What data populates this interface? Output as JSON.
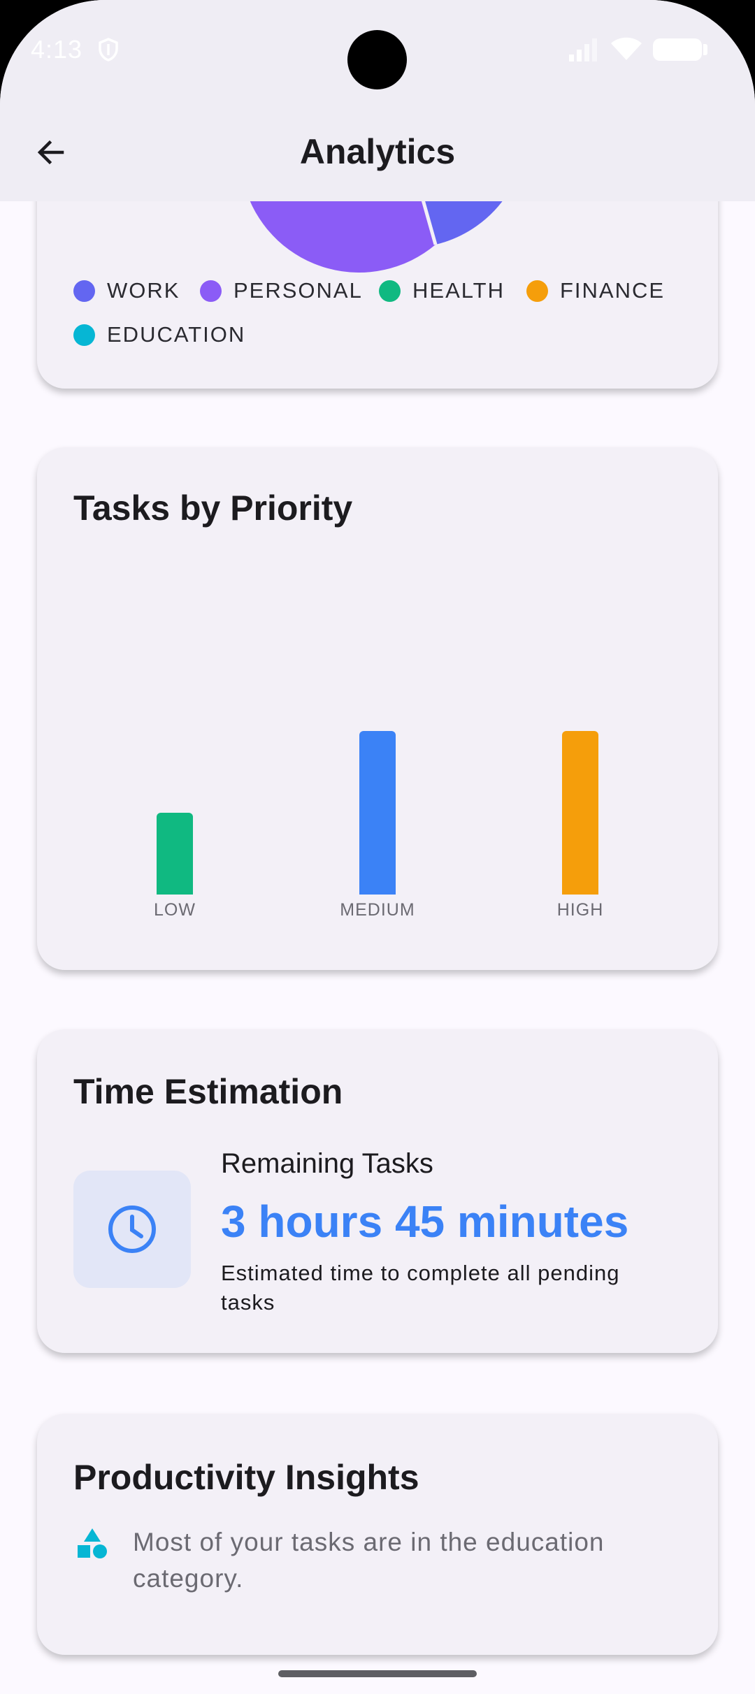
{
  "status_bar": {
    "time": "4:13"
  },
  "app_bar": {
    "title": "Analytics"
  },
  "category_card": {
    "legend": [
      {
        "label": "WORK",
        "color": "#6366f1"
      },
      {
        "label": "PERSONAL",
        "color": "#8b5cf6"
      },
      {
        "label": "HEALTH",
        "color": "#10b981"
      },
      {
        "label": "FINANCE",
        "color": "#f59e0b"
      },
      {
        "label": "EDUCATION",
        "color": "#06b6d4"
      }
    ]
  },
  "priority_card": {
    "title": "Tasks by Priority"
  },
  "chart_data": {
    "type": "bar",
    "title": "Tasks by Priority",
    "categories": [
      "LOW",
      "MEDIUM",
      "HIGH"
    ],
    "values": [
      2,
      4,
      4
    ],
    "colors": [
      "#10b981",
      "#3b82f6",
      "#f59e0b"
    ],
    "ylim": [
      0,
      8
    ],
    "grid": false
  },
  "time_card": {
    "title": "Time Estimation",
    "label": "Remaining Tasks",
    "value": "3 hours 45 minutes",
    "description": "Estimated time to complete all pending tasks",
    "icon": "clock-icon",
    "accent": "#3b82f6"
  },
  "insights_card": {
    "title": "Productivity Insights",
    "icon": "category-shapes-icon",
    "text": "Most of your tasks are in the education category."
  }
}
